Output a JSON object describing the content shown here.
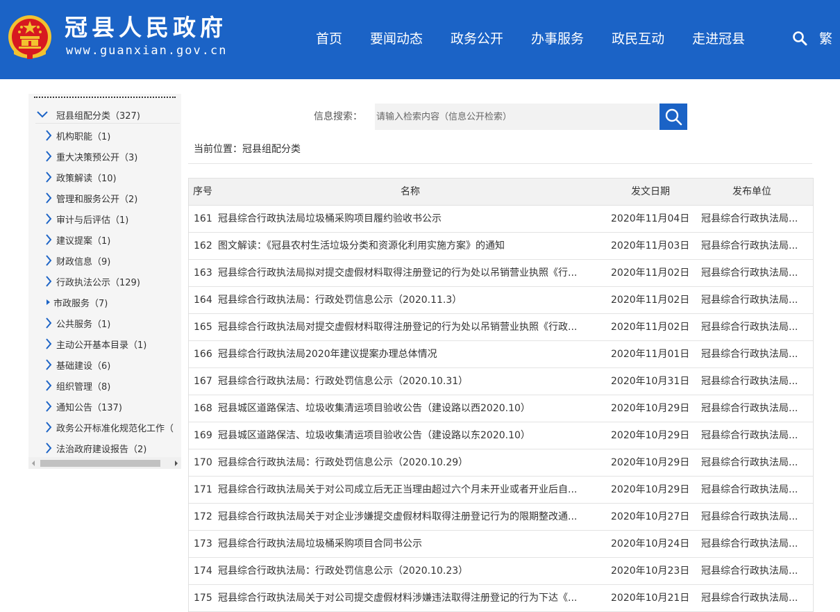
{
  "header": {
    "site_title": "冠县人民政府",
    "site_url": "www.guanxian.gov.cn",
    "nav": [
      "首页",
      "要闻动态",
      "政务公开",
      "办事服务",
      "政民互动",
      "走进冠县"
    ],
    "lang_toggle": "繁",
    "colors": {
      "header_bg": "#1b63c6",
      "emblem_red": "#d71920",
      "emblem_gold": "#f2c230"
    }
  },
  "sidebar": {
    "root_label": "冠县组配分类（327)",
    "items": [
      {
        "label": "机构职能（1)",
        "type": "branch"
      },
      {
        "label": "重大决策预公开（3)",
        "type": "branch"
      },
      {
        "label": "政策解读（10)",
        "type": "branch"
      },
      {
        "label": "管理和服务公开（2)",
        "type": "branch"
      },
      {
        "label": "审计与后评估（1)",
        "type": "branch"
      },
      {
        "label": "建议提案（1)",
        "type": "branch"
      },
      {
        "label": "财政信息（9)",
        "type": "branch"
      },
      {
        "label": "行政执法公示（129)",
        "type": "branch"
      },
      {
        "label": "市政服务（7)",
        "type": "leaf"
      },
      {
        "label": "公共服务（1)",
        "type": "branch"
      },
      {
        "label": "主动公开基本目录（1)",
        "type": "branch"
      },
      {
        "label": "基础建设（6)",
        "type": "branch"
      },
      {
        "label": "组织管理（8)",
        "type": "branch"
      },
      {
        "label": "通知公告（137)",
        "type": "branch"
      },
      {
        "label": "政务公开标准化规范化工作（",
        "type": "branch"
      },
      {
        "label": "法治政府建设报告（2)",
        "type": "branch"
      }
    ]
  },
  "search": {
    "label": "信息搜索：",
    "placeholder": "请输入检索内容（信息公开检索）"
  },
  "breadcrumb": "当前位置：冠县组配分类",
  "table": {
    "headers": {
      "no": "序号",
      "title": "名称",
      "date": "发文日期",
      "unit": "发布单位"
    },
    "rows": [
      {
        "no": "161",
        "title": "冠县综合行政执法局垃圾桶采购项目履约验收书公示",
        "date": "2020年11月04日",
        "unit": "冠县综合行政执法局..."
      },
      {
        "no": "162",
        "title": "图文解读：《冠县农村生活垃圾分类和资源化利用实施方案》的通知",
        "date": "2020年11月03日",
        "unit": "冠县综合行政执法局..."
      },
      {
        "no": "163",
        "title": "冠县综合行政执法局拟对提交虚假材料取得注册登记的行为处以吊销营业执照《行...",
        "date": "2020年11月02日",
        "unit": "冠县综合行政执法局..."
      },
      {
        "no": "164",
        "title": "冠县综合行政执法局：行政处罚信息公示（2020.11.3）",
        "date": "2020年11月02日",
        "unit": "冠县综合行政执法局..."
      },
      {
        "no": "165",
        "title": "冠县综合行政执法局对提交虚假材料取得注册登记的行为处以吊销营业执照《行政...",
        "date": "2020年11月02日",
        "unit": "冠县综合行政执法局..."
      },
      {
        "no": "166",
        "title": "冠县综合行政执法局2020年建议提案办理总体情况",
        "date": "2020年11月01日",
        "unit": "冠县综合行政执法局..."
      },
      {
        "no": "167",
        "title": "冠县综合行政执法局：行政处罚信息公示（2020.10.31）",
        "date": "2020年10月31日",
        "unit": "冠县综合行政执法局..."
      },
      {
        "no": "168",
        "title": "冠县城区道路保洁、垃圾收集清运项目验收公告（建设路以西2020.10）",
        "date": "2020年10月29日",
        "unit": "冠县综合行政执法局..."
      },
      {
        "no": "169",
        "title": "冠县城区道路保洁、垃圾收集清运项目验收公告（建设路以东2020.10）",
        "date": "2020年10月29日",
        "unit": "冠县综合行政执法局..."
      },
      {
        "no": "170",
        "title": "冠县综合行政执法局：行政处罚信息公示（2020.10.29）",
        "date": "2020年10月29日",
        "unit": "冠县综合行政执法局..."
      },
      {
        "no": "171",
        "title": "冠县综合行政执法局关于对公司成立后无正当理由超过六个月未开业或者开业后自...",
        "date": "2020年10月29日",
        "unit": "冠县综合行政执法局..."
      },
      {
        "no": "172",
        "title": "冠县综合行政执法局关于对企业涉嫌提交虚假材料取得注册登记行为的限期整改通...",
        "date": "2020年10月27日",
        "unit": "冠县综合行政执法局..."
      },
      {
        "no": "173",
        "title": "冠县综合行政执法局垃圾桶采购项目合同书公示",
        "date": "2020年10月24日",
        "unit": "冠县综合行政执法局..."
      },
      {
        "no": "174",
        "title": "冠县综合行政执法局：行政处罚信息公示（2020.10.23）",
        "date": "2020年10月23日",
        "unit": "冠县综合行政执法局..."
      },
      {
        "no": "175",
        "title": "冠县综合行政执法局关于对公司提交虚假材料涉嫌违法取得注册登记的行为下达《...",
        "date": "2020年10月21日",
        "unit": "冠县综合行政执法局..."
      }
    ]
  }
}
